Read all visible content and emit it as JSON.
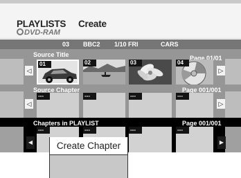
{
  "header": {
    "title": "PLAYLISTS",
    "subtitle": "DVD-RAM",
    "mode": "Create"
  },
  "info": {
    "number": "03",
    "channel": "BBC2",
    "date": "1/10 FRI",
    "title": "CARS"
  },
  "source_title": {
    "label": "Source Title",
    "page": "Page 01/01",
    "items": [
      {
        "num": "01",
        "icon": "car-thumbnail"
      },
      {
        "num": "02",
        "icon": "boat-thumbnail"
      },
      {
        "num": "03",
        "icon": "flower-thumbnail"
      },
      {
        "num": "04",
        "icon": "disc-thumbnail"
      }
    ]
  },
  "source_chapter": {
    "label": "Source Chapter",
    "page": "Page 001/001",
    "items": [
      {
        "num": "---"
      },
      {
        "num": "---"
      },
      {
        "num": "---"
      },
      {
        "num": "---"
      }
    ]
  },
  "chapters_in_playlist": {
    "label": "Chapters in PLAYLIST",
    "page": "Page 001/001",
    "items": [
      {
        "num": "---"
      },
      {
        "num": "---"
      },
      {
        "num": "---"
      },
      {
        "num": "---"
      }
    ]
  },
  "menu": {
    "items": [
      "Create Chapter"
    ]
  },
  "arrows": {
    "left": "◁",
    "right": "▷",
    "left_solid": "◀",
    "right_solid": "▶"
  }
}
